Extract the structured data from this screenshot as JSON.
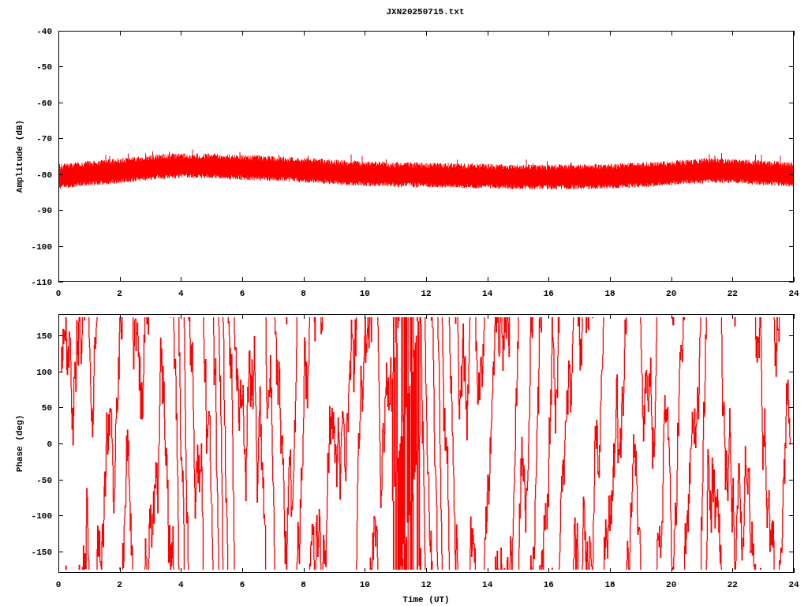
{
  "title": "JXN20250715.txt",
  "panels": [
    {
      "kind": "amplitude",
      "ylabel": "Amplitude (dB)",
      "yticks": [
        "-40",
        "-50",
        "-60",
        "-70",
        "-80",
        "-90",
        "-100",
        "-110"
      ],
      "xticks": [
        "0",
        "2",
        "4",
        "6",
        "8",
        "10",
        "12",
        "14",
        "16",
        "18",
        "20",
        "22",
        "24"
      ]
    },
    {
      "kind": "phase",
      "ylabel": "Phase (deg)",
      "yticks": [
        "150",
        "100",
        "50",
        "0",
        "-50",
        "-100",
        "-150"
      ],
      "xticks": [
        "0",
        "2",
        "4",
        "6",
        "8",
        "10",
        "12",
        "14",
        "16",
        "18",
        "20",
        "22",
        "24"
      ]
    }
  ],
  "xlabel": "Time (UT)"
}
